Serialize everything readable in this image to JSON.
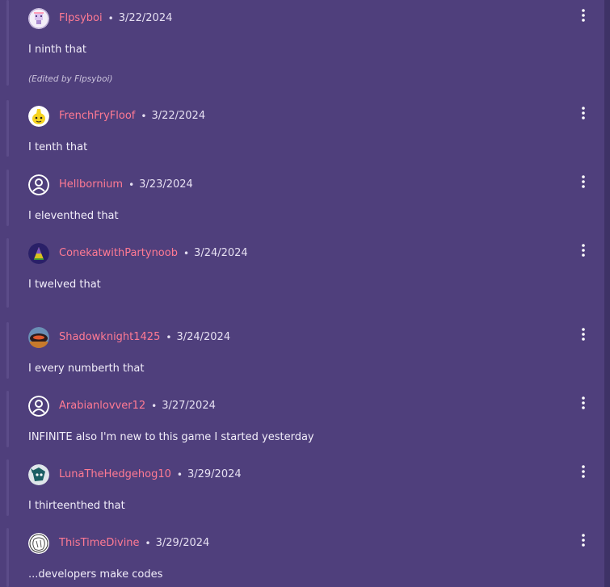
{
  "colors": {
    "background": "#4f3f7c",
    "username": "#ff7a93",
    "text": "#f2eefa"
  },
  "comments": [
    {
      "username": "Flpsyboi",
      "date": "3/22/2024",
      "body": "I ninth that",
      "edited": "(Edited by Flpsyboi)",
      "avatar_icon": "pixel-character-avatar-icon",
      "menu_icon": "kebab-menu-icon"
    },
    {
      "username": "FrenchFryFloof",
      "date": "3/22/2024",
      "body": "I tenth that",
      "avatar_icon": "yellow-character-avatar-icon",
      "menu_icon": "kebab-menu-icon"
    },
    {
      "username": "Hellbornium",
      "date": "3/23/2024",
      "body": "I eleventhed that",
      "avatar_icon": "default-user-avatar-icon",
      "menu_icon": "kebab-menu-icon"
    },
    {
      "username": "ConekatwithPartynoob",
      "date": "3/24/2024",
      "body": "I twelved that",
      "avatar_icon": "party-hat-avatar-icon",
      "menu_icon": "kebab-menu-icon"
    },
    {
      "username": "Shadowknight1425",
      "date": "3/24/2024",
      "body": "I every numberth that",
      "avatar_icon": "shadow-knight-avatar-icon",
      "menu_icon": "kebab-menu-icon"
    },
    {
      "username": "Arabianlovver12",
      "date": "3/27/2024",
      "body": "INFINITE also I'm new to this game I started yesterday",
      "avatar_icon": "default-user-avatar-icon",
      "menu_icon": "kebab-menu-icon"
    },
    {
      "username": "LunaTheHedgehog10",
      "date": "3/29/2024",
      "body": "I thirteenthed that",
      "avatar_icon": "hedgehog-avatar-icon",
      "menu_icon": "kebab-menu-icon"
    },
    {
      "username": "ThisTimeDivine",
      "date": "3/29/2024",
      "body": "...developers make codes",
      "avatar_icon": "sketch-avatar-icon",
      "menu_icon": "kebab-menu-icon"
    }
  ]
}
